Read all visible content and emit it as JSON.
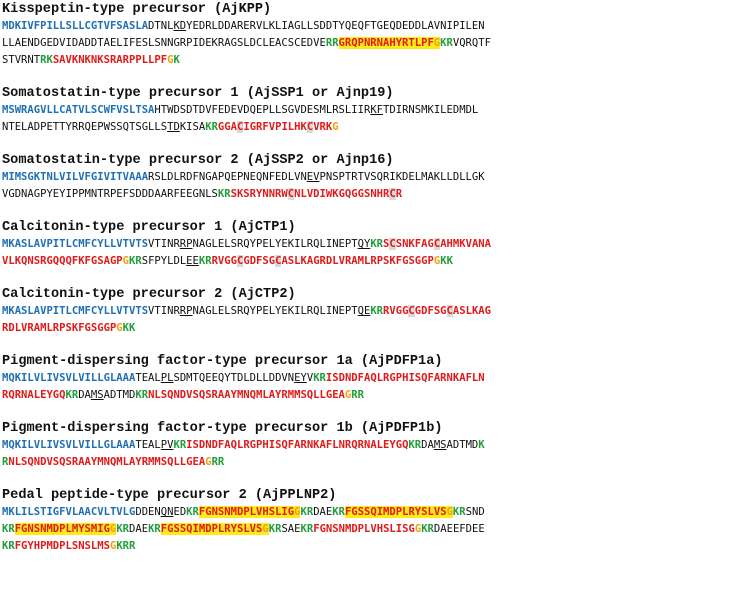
{
  "entries": [
    {
      "id": "ajkpp",
      "title": "Kisspeptin-type precursor (AjKPP)",
      "lines": [
        [
          [
            "MDKIVFPILLSLLCGTVFSASLA",
            "sig"
          ],
          [
            "DTNL",
            ""
          ],
          [
            "KD",
            "ul"
          ],
          [
            "YEDRLDDARERVLKLIAGLLSDDTYQEQFTGEQDEDDLAVNIPILEN",
            ""
          ]
        ],
        [
          [
            "LLAENDGEDVIDADDTAELIFESLSNNGRPIDEKRAGSLDCLEACSCEDVE",
            ""
          ],
          [
            "RR",
            "cleave"
          ],
          [
            "GRQPNRNAHYRTLPF",
            "pep hl"
          ],
          [
            "G",
            "gly hl"
          ],
          [
            "KR",
            "cleave"
          ],
          [
            "VQRQTF",
            ""
          ]
        ],
        [
          [
            "STVRNT",
            ""
          ],
          [
            "RK",
            "cleave"
          ],
          [
            "SAVKNKNKSRARPPLLPF",
            "pep"
          ],
          [
            "G",
            "gly"
          ],
          [
            "K",
            "cleave"
          ]
        ]
      ]
    },
    {
      "id": "ajssp1",
      "title": "Somatostatin-type precursor 1 (AjSSP1 or Ajnp19)",
      "lines": [
        [
          [
            "MSWRAGVLLCATVLSCWFVSLTSA",
            "sig"
          ],
          [
            "HTWDSDTDVFEDEVDQEPLLSGVDESMLRSLIIR",
            ""
          ],
          [
            "KF",
            "ul"
          ],
          [
            "TDIRNSMKILEDMDL",
            ""
          ]
        ],
        [
          [
            "NTELADPETTYRRQEPWSSQTSGLLS",
            ""
          ],
          [
            "TD",
            "ul"
          ],
          [
            "KISA",
            ""
          ],
          [
            "KR",
            "cleave"
          ],
          [
            "GGA",
            "pep"
          ],
          [
            "C",
            "pep cys"
          ],
          [
            "IGRFVPILHK",
            "pep"
          ],
          [
            "C",
            "pep cys"
          ],
          [
            "VRK",
            "pep"
          ],
          [
            "G",
            "gly"
          ]
        ]
      ]
    },
    {
      "id": "ajssp2",
      "title": "Somatostatin-type precursor 2 (AjSSP2 or Ajnp16)",
      "lines": [
        [
          [
            "MIMSGKTNLVILVFGIVITVAAA",
            "sig"
          ],
          [
            "RSLDLRDFNGAPQEPNEQNFEDLVN",
            ""
          ],
          [
            "EV",
            "ul"
          ],
          [
            "PNSPTRTVSQRIKDELMAKLLDLLGK",
            ""
          ]
        ],
        [
          [
            "VGDNAGPYEYIPPMNTRPEFSDDDAARFEEGNLS",
            ""
          ],
          [
            "KR",
            "cleave"
          ],
          [
            "SKSRYNNRW",
            "pep"
          ],
          [
            "C",
            "pep cys"
          ],
          [
            "NLVDIWKGQGGSNHR",
            "pep"
          ],
          [
            "C",
            "pep cys"
          ],
          [
            "R",
            "pep"
          ]
        ]
      ]
    },
    {
      "id": "ajctp1",
      "title": "Calcitonin-type precursor 1 (AjCTP1)",
      "lines": [
        [
          [
            "MKASLAVPITLCMFCYLLVTVTS",
            "sig"
          ],
          [
            "VTINR",
            ""
          ],
          [
            "RP",
            "ul"
          ],
          [
            "NAGLELSRQYPELYEKILRQLINEPT",
            ""
          ],
          [
            "QY",
            "ul"
          ],
          [
            "KR",
            "cleave"
          ],
          [
            "S",
            "pep"
          ],
          [
            "C",
            "pep cys"
          ],
          [
            "SNKFAG",
            "pep"
          ],
          [
            "C",
            "pep cys"
          ],
          [
            "AHMKVANA",
            "pep"
          ]
        ],
        [
          [
            "VLKQNSRGQQQFKFGSAGP",
            "pep"
          ],
          [
            "G",
            "gly"
          ],
          [
            "KR",
            "cleave"
          ],
          [
            "SFPYLDL",
            ""
          ],
          [
            "EE",
            "ul"
          ],
          [
            "KR",
            "cleave"
          ],
          [
            "RVGG",
            "pep"
          ],
          [
            "C",
            "pep cys"
          ],
          [
            "GDFSG",
            "pep"
          ],
          [
            "C",
            "pep cys"
          ],
          [
            "ASLKAGRDLVRAMLRPSKFGSGGP",
            "pep"
          ],
          [
            "G",
            "gly"
          ],
          [
            "KK",
            "cleave"
          ]
        ]
      ]
    },
    {
      "id": "ajctp2",
      "title": "Calcitonin-type precursor 2 (AjCTP2)",
      "lines": [
        [
          [
            "MKASLAVPITLCMFCYLLVTVTS",
            "sig"
          ],
          [
            "VTINR",
            ""
          ],
          [
            "RP",
            "ul"
          ],
          [
            "NAGLELSRQYPELYEKILRQLINEPT",
            ""
          ],
          [
            "QE",
            "ul"
          ],
          [
            "KR",
            "cleave"
          ],
          [
            "RVGG",
            "pep"
          ],
          [
            "C",
            "pep cys"
          ],
          [
            "GDFSG",
            "pep"
          ],
          [
            "C",
            "pep cys"
          ],
          [
            "ASLKAG",
            "pep"
          ]
        ],
        [
          [
            "RDLVRAMLRPSKFGSGGP",
            "pep"
          ],
          [
            "G",
            "gly"
          ],
          [
            "KK",
            "cleave"
          ]
        ]
      ]
    },
    {
      "id": "ajpdfp1a",
      "title": "Pigment-dispersing factor-type precursor 1a (AjPDFP1a)",
      "lines": [
        [
          [
            "MQKILVLIVSVLVILLGLAAA",
            "sig"
          ],
          [
            "TEAL",
            ""
          ],
          [
            "PL",
            "ul"
          ],
          [
            "SDMTQEEQYTDLDLLDDVN",
            ""
          ],
          [
            "EY",
            "ul"
          ],
          [
            "V",
            ""
          ],
          [
            "KR",
            "cleave"
          ],
          [
            "ISDNDFAQLRGPHISQFARNKAFLN",
            "pep"
          ]
        ],
        [
          [
            "RQRNALEYGQ",
            "pep"
          ],
          [
            "KR",
            "cleave"
          ],
          [
            "DA",
            ""
          ],
          [
            "MS",
            "ul"
          ],
          [
            "ADTMD",
            ""
          ],
          [
            "KR",
            "cleave"
          ],
          [
            "NLSQNDVSQSRAAYMNQMLAYRMMSQLLGEA",
            "pep"
          ],
          [
            "G",
            "gly"
          ],
          [
            "RR",
            "cleave"
          ]
        ]
      ]
    },
    {
      "id": "ajpdfp1b",
      "title": "Pigment-dispersing factor-type precursor 1b (AjPDFP1b)",
      "lines": [
        [
          [
            "MQKILVLIVSVLVILLGLAAA",
            "sig"
          ],
          [
            "TEAL",
            ""
          ],
          [
            "PV",
            "ul"
          ],
          [
            "KR",
            "cleave"
          ],
          [
            "ISDNDFAQLRGPHISQFARNKAFLNRQRNALEYGQ",
            "pep"
          ],
          [
            "KR",
            "cleave"
          ],
          [
            "DA",
            ""
          ],
          [
            "MS",
            "ul"
          ],
          [
            "ADTMD",
            ""
          ],
          [
            "K",
            "cleave"
          ]
        ],
        [
          [
            "R",
            "cleave"
          ],
          [
            "NLSQNDVSQSRAAYMNQMLAYRMMSQLLGEA",
            "pep"
          ],
          [
            "G",
            "gly"
          ],
          [
            "RR",
            "cleave"
          ]
        ]
      ]
    },
    {
      "id": "ajpplnp2",
      "title": "Pedal peptide-type precursor 2 (AjPPLNP2)",
      "lines": [
        [
          [
            "MKLILSTIGFVLAACVLTVLG",
            "sig"
          ],
          [
            "DDEN",
            ""
          ],
          [
            "QN",
            "ul"
          ],
          [
            "ED",
            ""
          ],
          [
            "KR",
            "cleave"
          ],
          [
            "FGNSNMDPLVHSLIG",
            "pep hl"
          ],
          [
            "G",
            "gly hl"
          ],
          [
            "KR",
            "cleave"
          ],
          [
            "DAE",
            ""
          ],
          [
            "KR",
            "cleave"
          ],
          [
            "FGSSQIMDPLRYSLVS",
            "pep hl"
          ],
          [
            "G",
            "gly hl"
          ],
          [
            "KR",
            "cleave"
          ],
          [
            "SND",
            ""
          ]
        ],
        [
          [
            "KR",
            "cleave"
          ],
          [
            "FGNSNMDPLMYSMIG",
            "pep hl"
          ],
          [
            "G",
            "gly hl"
          ],
          [
            "KR",
            "cleave"
          ],
          [
            "DAE",
            ""
          ],
          [
            "KR",
            "cleave"
          ],
          [
            "FGSSQIMDPLRYSLVS",
            "pep hl"
          ],
          [
            "G",
            "gly hl"
          ],
          [
            "KR",
            "cleave"
          ],
          [
            "SAE",
            ""
          ],
          [
            "KR",
            "cleave"
          ],
          [
            "FGNSNMDPLVHSLISG",
            "pep"
          ],
          [
            "G",
            "gly"
          ],
          [
            "KR",
            "cleave"
          ],
          [
            "DAEEFDEE",
            ""
          ]
        ],
        [
          [
            "KR",
            "cleave"
          ],
          [
            "FGYHPMDPLSNSLMS",
            "pep"
          ],
          [
            "G",
            "gly"
          ],
          [
            "KRR",
            "cleave"
          ]
        ]
      ]
    }
  ]
}
